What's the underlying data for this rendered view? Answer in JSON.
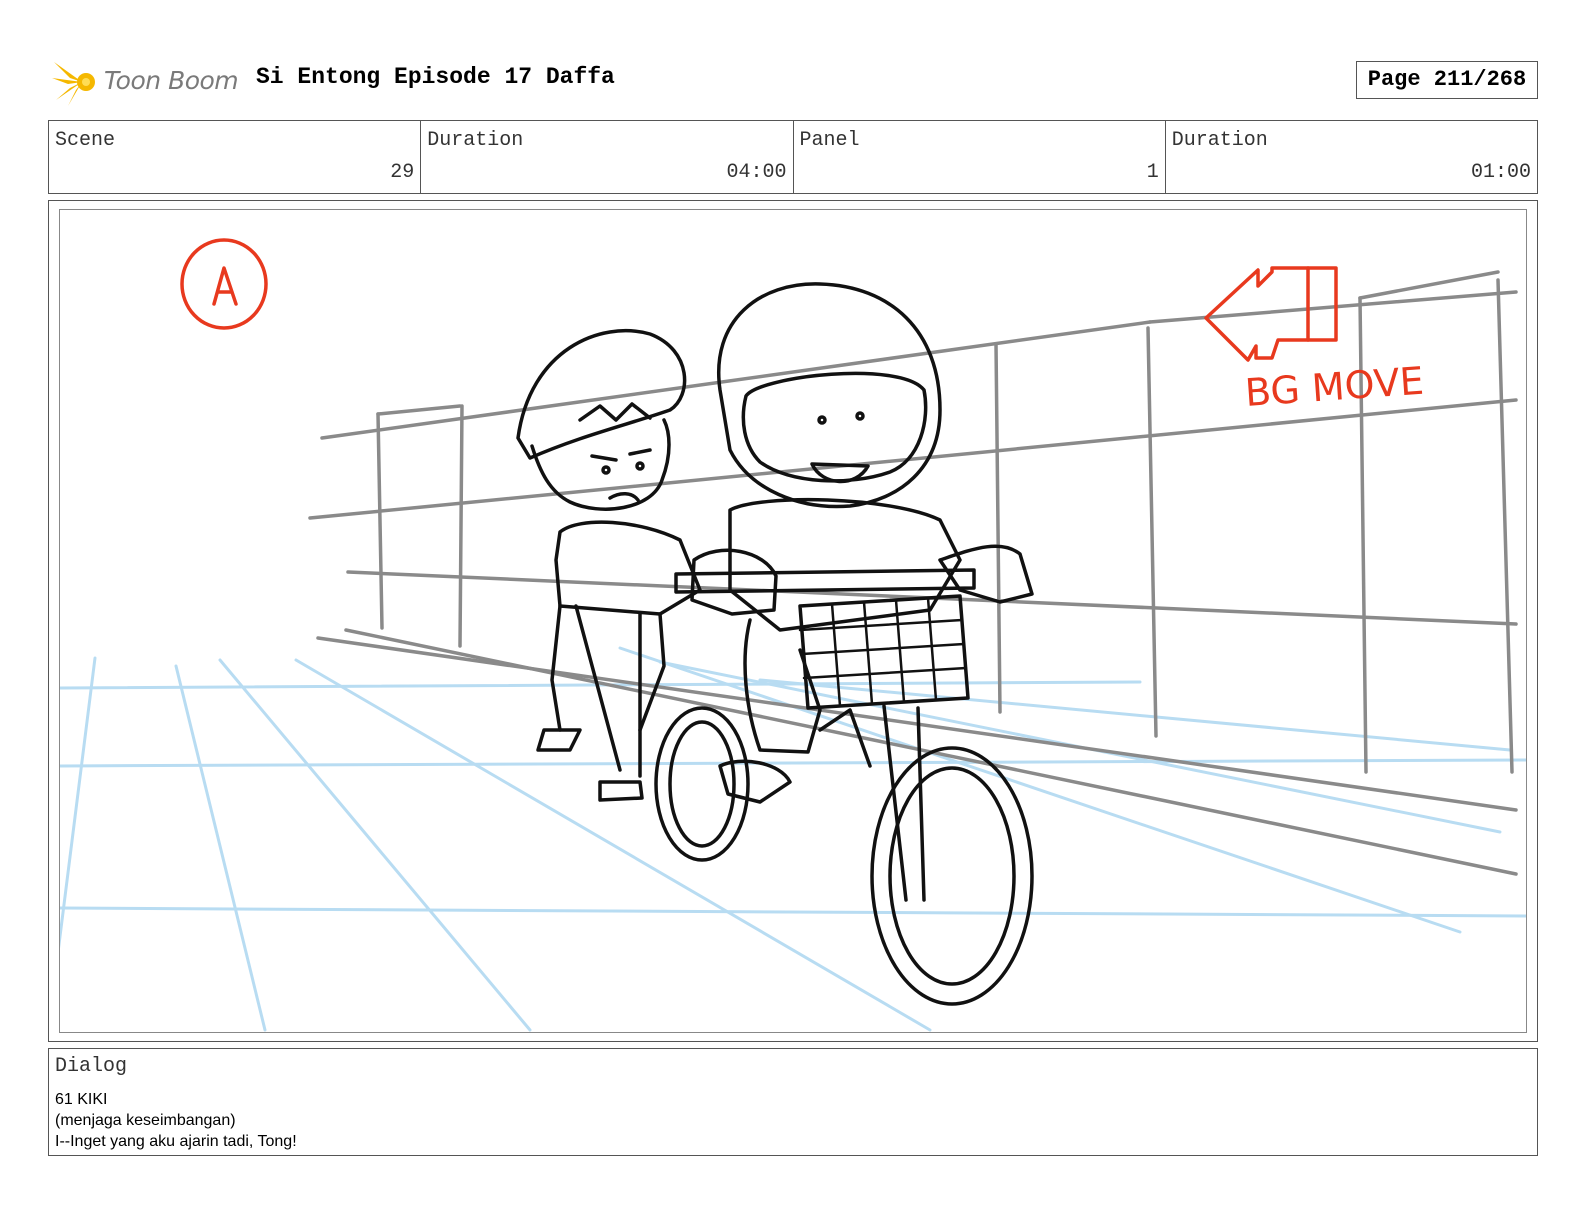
{
  "header": {
    "logo_text": "Toon Boom",
    "title": "Si Entong Episode 17 Daffa",
    "page": "Page 211/268"
  },
  "info": [
    {
      "label": "Scene",
      "value": "29"
    },
    {
      "label": "Duration",
      "value": "04:00"
    },
    {
      "label": "Panel",
      "value": "1"
    },
    {
      "label": "Duration",
      "value": "01:00"
    }
  ],
  "panel": {
    "marker_letter": "A",
    "bg_note": "BG MOVE",
    "sketch_colors": {
      "ink": "#111111",
      "wall": "#8a8a8a",
      "floor": "#b8dcf2",
      "note": "#e8391e"
    },
    "icons": [
      "toon-boom-logo-icon",
      "left-arrow-icon"
    ]
  },
  "dialog": {
    "label": "Dialog",
    "lines": [
      "61 KIKI",
      "(menjaga keseimbangan)",
      "I--Inget yang aku ajarin tadi, Tong!"
    ]
  }
}
